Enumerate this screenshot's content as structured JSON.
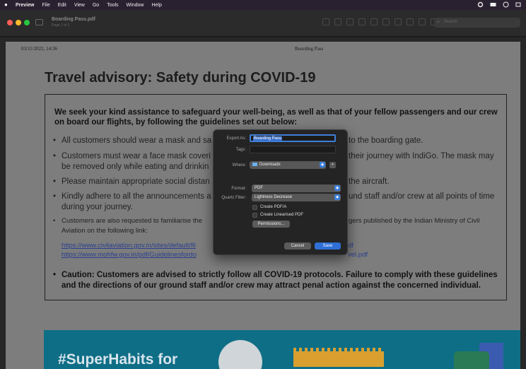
{
  "menubar": {
    "items": [
      "Preview",
      "File",
      "Edit",
      "View",
      "Go",
      "Tools",
      "Window",
      "Help"
    ]
  },
  "window": {
    "title": "Boarding Pass.pdf",
    "subtitle": "Page 2 of 2",
    "search_placeholder": "Search"
  },
  "document": {
    "date_time": "03/11/2022, 14:36",
    "page_header": "Boarding Pass",
    "heading": "Travel advisory: Safety during COVID-19",
    "intro": "We seek your kind assistance to safeguard your well-being, as well as that of your fellow passengers and our crew on board our flights, by following the guidelines set out below:",
    "bullets": [
      "All customers should wear a mask and sa",
      "Customers must wear a face mask coveri",
      "be removed only while eating and drinkin",
      "Please maintain appropriate social distan",
      "Kindly adhere to all the announcements a",
      "during your journey.",
      "Customers are also requested to familiarise the",
      "Aviation on the following link:"
    ],
    "bullets_right": [
      "to the boarding gate.",
      "their journey with IndiGo. The mask may",
      "the aircraft.",
      "und staff and/or crew at all points of time",
      "gers published by the Indian Ministry of Civil"
    ],
    "links": [
      "https://www.civilaviation.gov.in/sites/default/fil",
      "https://www.mohfw.gov.in/pdf/Guidelinesfordo"
    ],
    "links_right": [
      "df",
      "vel.pdf"
    ],
    "caution": "Caution: Customers are advised to strictly follow all COVID-19 protocols. Failure to comply with these guidelines and the directions of our ground staff and/or crew may attract penal action against the concerned individual.",
    "banner_text": "#SuperHabits for"
  },
  "dialog": {
    "export_as_label": "Export As:",
    "export_as_value": "Boarding Pass",
    "tags_label": "Tags:",
    "where_label": "Where:",
    "where_value": "Downloads",
    "format_label": "Format:",
    "format_value": "PDF",
    "quartz_label": "Quartz Filter:",
    "quartz_value": "Lightness Decrease",
    "create_pdfa": "Create PDF/A",
    "create_linearised": "Create Linearised PDF",
    "permissions": "Permissions...",
    "cancel": "Cancel",
    "save": "Save"
  }
}
